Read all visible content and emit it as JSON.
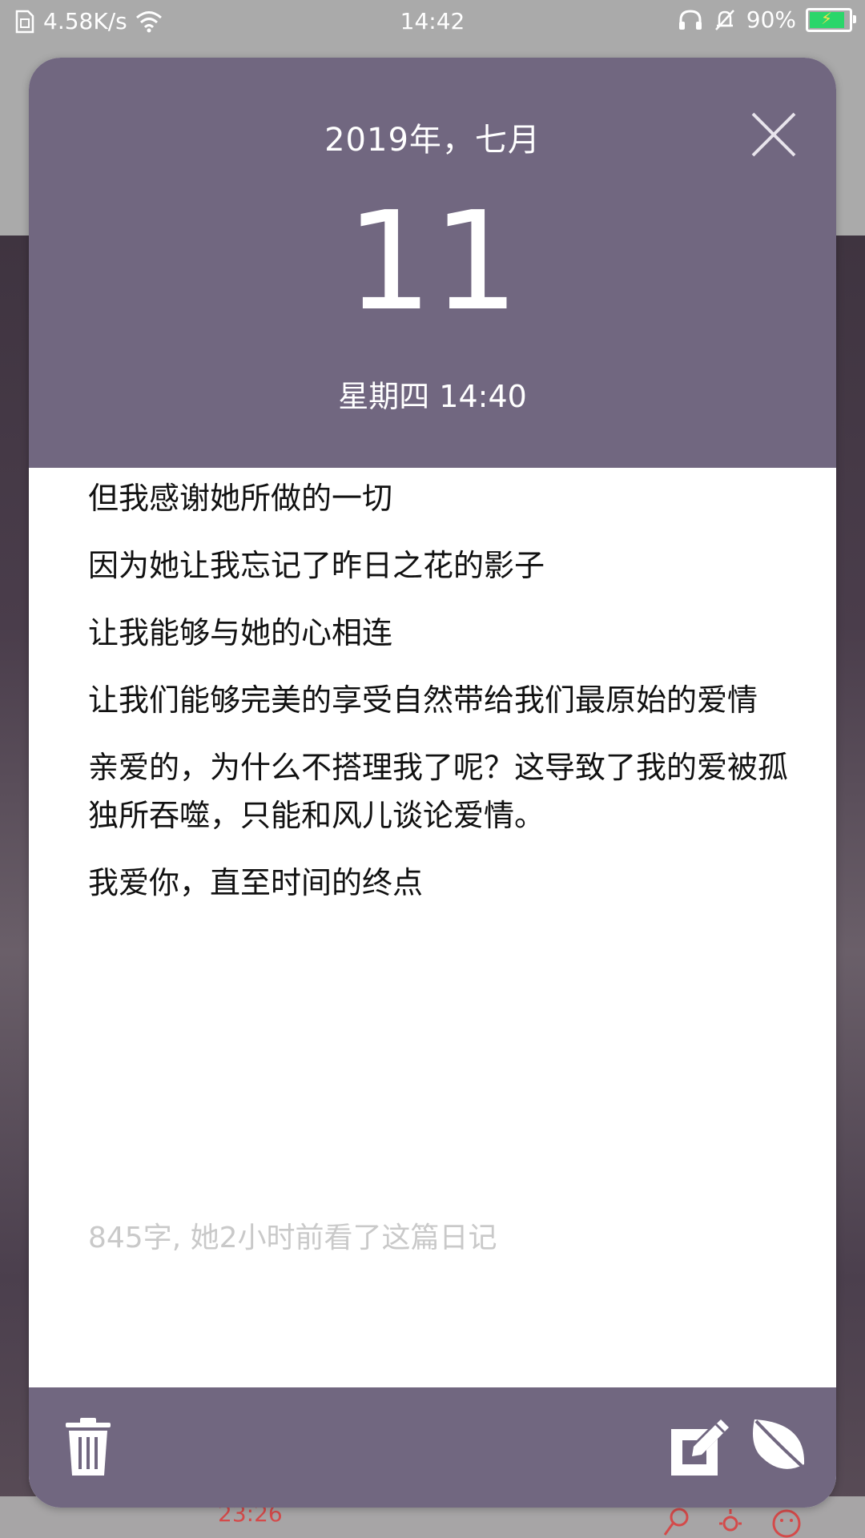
{
  "status_bar": {
    "network_speed": "4.58K/s",
    "time": "14:42",
    "battery_percent": "90%",
    "battery_level": 0.9
  },
  "diary": {
    "month_label": "2019年，七月",
    "day": "11",
    "weekday_time": "星期四 14:40",
    "paragraphs": [
      "但我感谢她所做的一切",
      "因为她让我忘记了昨日之花的影子",
      "让我能够与她的心相连",
      "让我们能够完美的享受自然带给我们最原始的爱情",
      "亲爱的，为什么不搭理我了呢？这导致了我的爱被孤独所吞噬，只能和风儿谈论爱情。",
      "我爱你，直至时间的终点"
    ],
    "meta": "845字, 她2小时前看了这篇日记"
  },
  "background": {
    "time": "23:26"
  },
  "colors": {
    "header": "#716780",
    "footer": "#716780",
    "meta_text": "#c9c9c9",
    "background_accent": "#d44a4a"
  },
  "icons": {
    "close": "close-icon",
    "trash": "trash-icon",
    "edit": "edit-icon",
    "leaf": "leaf-icon"
  }
}
